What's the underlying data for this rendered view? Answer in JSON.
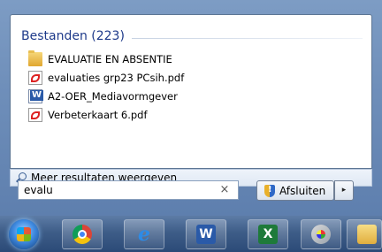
{
  "start_menu": {
    "results_group": {
      "title": "Bestanden (223)"
    },
    "results": [
      {
        "label": "EVALUATIE EN ABSENTIE",
        "icon": "folder-icon"
      },
      {
        "label": "evaluaties grp23 PCsih.pdf",
        "icon": "pdf-icon"
      },
      {
        "label": "A2-OER_Mediavormgever",
        "icon": "word-document-icon"
      },
      {
        "label": "Verbeterkaart 6.pdf",
        "icon": "pdf-icon"
      }
    ],
    "more_results_label": "Meer resultaten weergeven",
    "search": {
      "value": "evalu",
      "clear_glyph": "×"
    },
    "shutdown": {
      "label": "Afsluiten",
      "arrow_glyph": "▸"
    }
  },
  "taskbar": {
    "apps": [
      {
        "name": "chrome",
        "icon": "chrome-icon"
      },
      {
        "name": "internet-explorer",
        "icon": "internet-explorer-icon"
      },
      {
        "name": "word",
        "icon": "word-icon",
        "glyph": "W"
      },
      {
        "name": "excel",
        "icon": "excel-icon",
        "glyph": "X"
      },
      {
        "name": "paint",
        "icon": "paint-icon"
      },
      {
        "name": "explorer",
        "icon": "folder-icon"
      }
    ],
    "ie_glyph": "e"
  }
}
